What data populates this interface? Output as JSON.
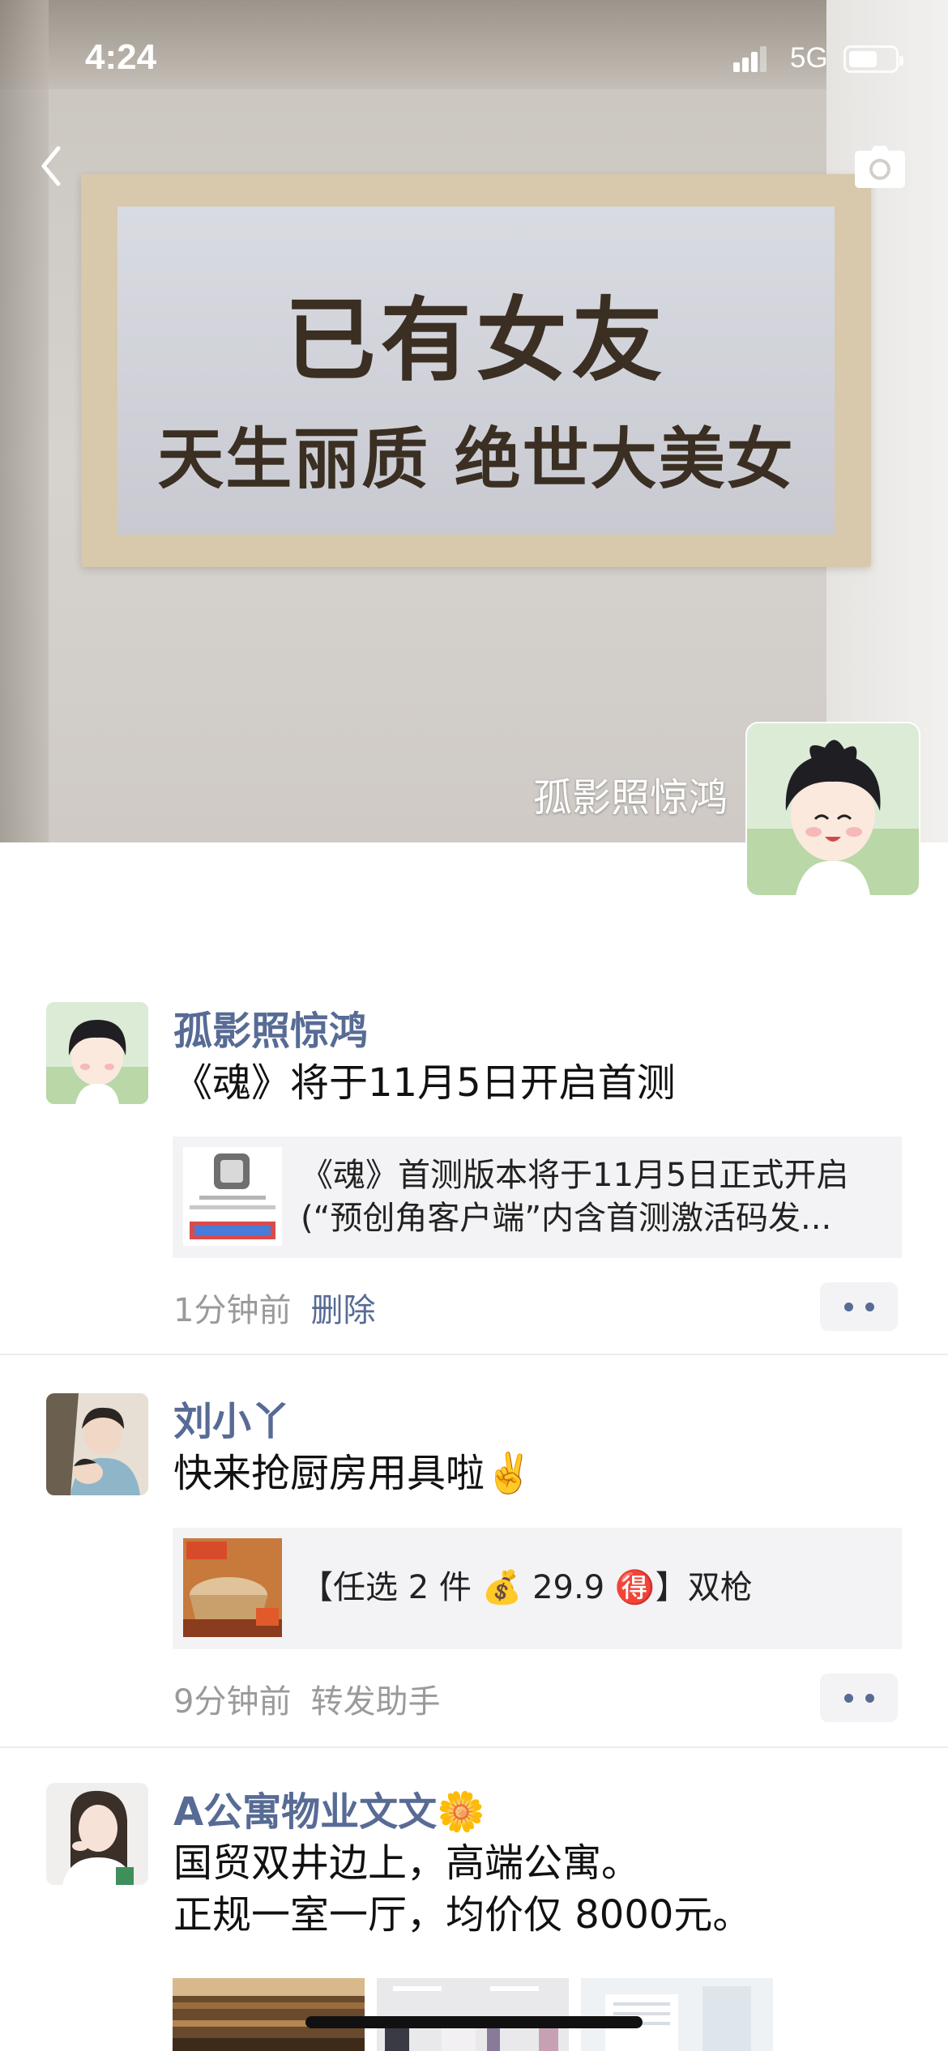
{
  "status_bar": {
    "time": "4:24",
    "network": "5G",
    "battery_level": 0.6
  },
  "cover": {
    "sign_line1": "已有女友",
    "sign_line2": "天生丽质 绝世大美女",
    "owner_name": "孤影照惊鸿"
  },
  "posts": [
    {
      "username": "孤影照惊鸿",
      "content": "《魂》将于11月5日开启首测",
      "link_card": {
        "line1": "《魂》首测版本将于11月5日正式开启",
        "line2": "(“预创角客户端”内含首测激活码发..."
      },
      "time_ago": "1分钟前",
      "action": "删除"
    },
    {
      "username": "刘小丫",
      "content": "快来抢厨房用具啦✌️",
      "link_card": {
        "line1": "【任选 2 件 💰 29.9 🉐】双枪"
      },
      "time_ago": "9分钟前",
      "source": "转发助手"
    },
    {
      "username": "A公寓物业文文🌼",
      "content_lines": [
        "国贸双井边上，高端公寓。",
        "正规一室一厅，均价仅 8000元。"
      ]
    }
  ]
}
